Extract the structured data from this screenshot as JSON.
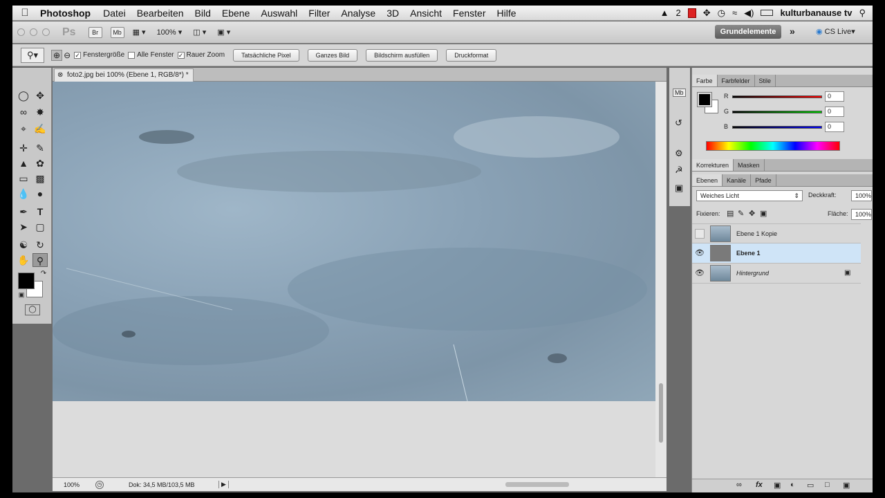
{
  "menubar": {
    "app_name": "Photoshop",
    "items": [
      "Datei",
      "Bearbeiten",
      "Bild",
      "Ebene",
      "Auswahl",
      "Filter",
      "Analyse",
      "3D",
      "Ansicht",
      "Fenster",
      "Hilfe"
    ],
    "status_number": "2",
    "user": "kulturbanause tv"
  },
  "appbar": {
    "logo": "Ps",
    "bridge": "Br",
    "minibridge": "Mb",
    "zoom": "100%",
    "workspace": "Grundelemente",
    "cs_live": "CS Live"
  },
  "options": {
    "check1": "Fenstergröße",
    "check2": "Alle Fenster",
    "check3": "Rauer Zoom",
    "btn1": "Tatsächliche Pixel",
    "btn2": "Ganzes Bild",
    "btn3": "Bildschirm ausfüllen",
    "btn4": "Druckformat"
  },
  "document": {
    "tab_title": "foto2.jpg bei 100% (Ebene 1, RGB/8*) *",
    "zoom": "100%",
    "doc_info": "Dok: 34,5 MB/103,5 MB"
  },
  "color_panel": {
    "tabs": [
      "Farbe",
      "Farbfelder",
      "Stile"
    ],
    "r_label": "R",
    "g_label": "G",
    "b_label": "B",
    "r": "0",
    "g": "0",
    "b": "0"
  },
  "adjust_panel": {
    "tabs": [
      "Korrekturen",
      "Masken"
    ]
  },
  "layers_panel": {
    "tabs": [
      "Ebenen",
      "Kanäle",
      "Pfade"
    ],
    "blend_mode": "Weiches Licht",
    "opacity_label": "Deckkraft:",
    "opacity": "100%",
    "lock_label": "Fixieren:",
    "fill_label": "Fläche:",
    "fill": "100%",
    "layers": [
      "Ebene 1 Kopie",
      "Ebene 1",
      "Hintergrund"
    ]
  },
  "colors": {
    "accent_blue": "#cfe4f7",
    "canvas": "#8ea6b8"
  }
}
